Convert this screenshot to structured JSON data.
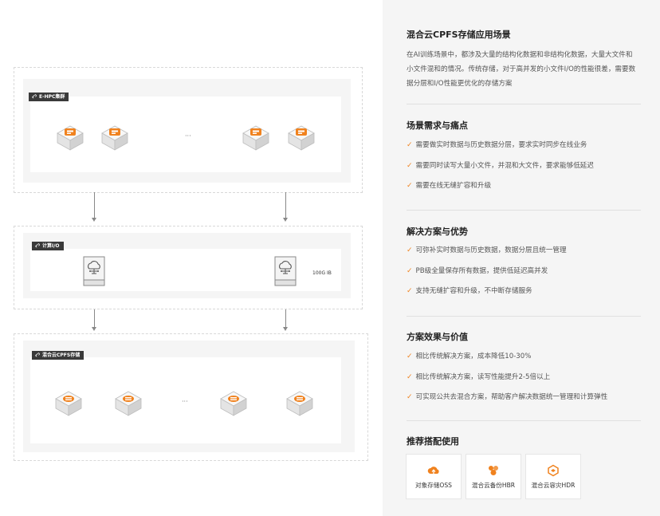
{
  "diagram": {
    "groups": [
      {
        "tag": "E-HPC集群",
        "nodes": 4,
        "ellipsis": "···"
      },
      {
        "tag": "计算I/O",
        "nodes": 2,
        "caption": "100G IB"
      },
      {
        "tag": "混合云CPFS存储",
        "nodes": 4,
        "ellipsis": "···"
      }
    ]
  },
  "panel": {
    "title": "混合云CPFS存储应用场景",
    "intro": "在AI训练场景中，都涉及大量的结构化数据和非结构化数据，大量大文件和小文件混和的情况。传统存储，对于高并发的小文件I/O的性能很差，需要数据分层和I/O性能更优化的存储方案",
    "sections": [
      {
        "title": "场景需求与痛点",
        "items": [
          "需要做实时数据与历史数据分层，要求实时同步在线业务",
          "需要同时读写大量小文件，并混和大文件，要求能够低延迟",
          "需要在线无缝扩容和升级"
        ]
      },
      {
        "title": "解决方案与优势",
        "items": [
          "可弥补实时数据与历史数据，数据分层且统一管理",
          "PB级全量保存所有数据，提供低延迟高并发",
          "支持无缝扩容和升级，不中断存储服务"
        ]
      },
      {
        "title": "方案效果与价值",
        "items": [
          "相比传统解决方案，成本降低10-30%",
          "相比传统解决方案，读写性能提升2-5倍以上",
          "可实现公共去混合方案，帮助客户解决数据统一管理和计算弹性"
        ]
      }
    ],
    "recommend_title": "推荐搭配使用",
    "products": [
      {
        "label": "对象存储OSS",
        "icon": "cloud-storage-icon"
      },
      {
        "label": "混合云备份HBR",
        "icon": "hybrid-backup-icon"
      },
      {
        "label": "混合云容灾HDR",
        "icon": "disaster-recovery-icon"
      }
    ],
    "check_symbol": "✓",
    "accent": "#f0821e"
  }
}
